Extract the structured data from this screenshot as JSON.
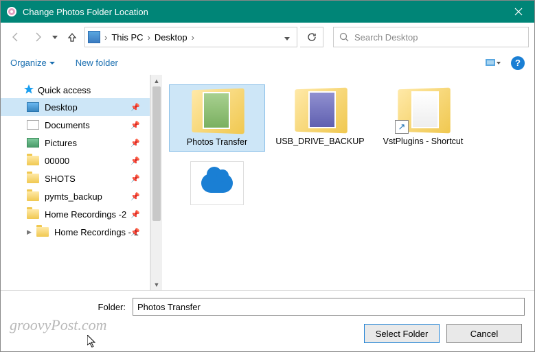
{
  "titlebar": {
    "title": "Change Photos Folder Location"
  },
  "nav": {
    "breadcrumb": [
      "This PC",
      "Desktop"
    ],
    "search_placeholder": "Search Desktop"
  },
  "toolbar": {
    "organize": "Organize",
    "new_folder": "New folder",
    "help": "?"
  },
  "sidebar": {
    "group": "Quick access",
    "items": [
      {
        "label": "Desktop",
        "icon": "desktop",
        "pinned": true,
        "selected": true
      },
      {
        "label": "Documents",
        "icon": "docs",
        "pinned": true
      },
      {
        "label": "Pictures",
        "icon": "pics",
        "pinned": true
      },
      {
        "label": "00000",
        "icon": "folder",
        "pinned": true
      },
      {
        "label": "SHOTS",
        "icon": "folder",
        "pinned": true
      },
      {
        "label": "pymts_backup",
        "icon": "folder",
        "pinned": true
      },
      {
        "label": "Home Recordings -2",
        "icon": "folder",
        "pinned": true
      },
      {
        "label": "Home Recordings - 1",
        "icon": "folder",
        "pinned": true
      }
    ]
  },
  "files": {
    "items": [
      {
        "label": "Photos Transfer",
        "type": "folder-thumb",
        "thumb": "t1",
        "selected": true
      },
      {
        "label": "USB_DRIVE_BACKUP",
        "type": "folder-thumb",
        "thumb": "t2"
      },
      {
        "label": "VstPlugins - Shortcut",
        "type": "folder-thumb",
        "thumb": "t3",
        "shortcut": true
      },
      {
        "label": "",
        "type": "onedrive"
      }
    ]
  },
  "bottom": {
    "folder_label": "Folder:",
    "folder_value": "Photos Transfer",
    "select_btn": "Select Folder",
    "cancel_btn": "Cancel"
  },
  "watermark": "groovyPost.com"
}
